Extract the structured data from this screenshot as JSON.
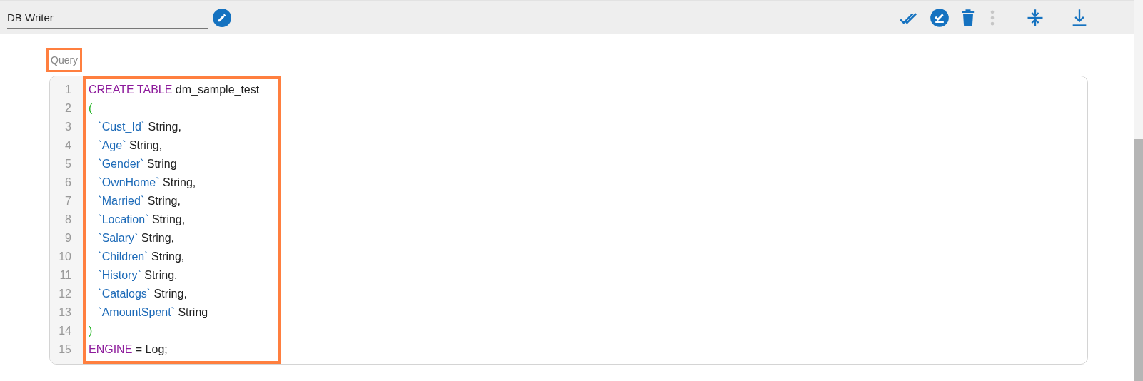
{
  "header": {
    "title_field": {
      "value": "DB Writer"
    }
  },
  "query": {
    "label": "Query",
    "highlighted": true,
    "lines": [
      {
        "number": "1",
        "tokens": [
          {
            "kind": "keyword",
            "text": "CREATE TABLE"
          },
          {
            "kind": "plain",
            "text": " dm_sample_test"
          }
        ]
      },
      {
        "number": "2",
        "tokens": [
          {
            "kind": "bracket",
            "text": "("
          }
        ]
      },
      {
        "number": "3",
        "tokens": [
          {
            "kind": "column",
            "text": "   `Cust_Id`"
          },
          {
            "kind": "plain",
            "text": " String,"
          }
        ]
      },
      {
        "number": "4",
        "tokens": [
          {
            "kind": "column",
            "text": "   `Age`"
          },
          {
            "kind": "plain",
            "text": " String,"
          }
        ]
      },
      {
        "number": "5",
        "tokens": [
          {
            "kind": "column",
            "text": "   `Gender`"
          },
          {
            "kind": "plain",
            "text": " String"
          }
        ]
      },
      {
        "number": "6",
        "tokens": [
          {
            "kind": "column",
            "text": "   `OwnHome`"
          },
          {
            "kind": "plain",
            "text": " String,"
          }
        ]
      },
      {
        "number": "7",
        "tokens": [
          {
            "kind": "column",
            "text": "   `Married`"
          },
          {
            "kind": "plain",
            "text": " String,"
          }
        ]
      },
      {
        "number": "8",
        "tokens": [
          {
            "kind": "column",
            "text": "   `Location`"
          },
          {
            "kind": "plain",
            "text": " String,"
          }
        ]
      },
      {
        "number": "9",
        "tokens": [
          {
            "kind": "column",
            "text": "   `Salary`"
          },
          {
            "kind": "plain",
            "text": " String,"
          }
        ]
      },
      {
        "number": "10",
        "tokens": [
          {
            "kind": "column",
            "text": "   `Children`"
          },
          {
            "kind": "plain",
            "text": " String,"
          }
        ]
      },
      {
        "number": "11",
        "tokens": [
          {
            "kind": "column",
            "text": "   `History`"
          },
          {
            "kind": "plain",
            "text": " String,"
          }
        ]
      },
      {
        "number": "12",
        "tokens": [
          {
            "kind": "column",
            "text": "   `Catalogs`"
          },
          {
            "kind": "plain",
            "text": " String,"
          }
        ]
      },
      {
        "number": "13",
        "tokens": [
          {
            "kind": "column",
            "text": "   `AmountSpent`"
          },
          {
            "kind": "plain",
            "text": " String"
          }
        ]
      },
      {
        "number": "14",
        "tokens": [
          {
            "kind": "bracket",
            "text": ")"
          }
        ]
      },
      {
        "number": "15",
        "tokens": [
          {
            "kind": "keyword",
            "text": "ENGINE"
          },
          {
            "kind": "plain",
            "text": " = Log;"
          }
        ]
      }
    ],
    "code_highlighted": true
  }
}
